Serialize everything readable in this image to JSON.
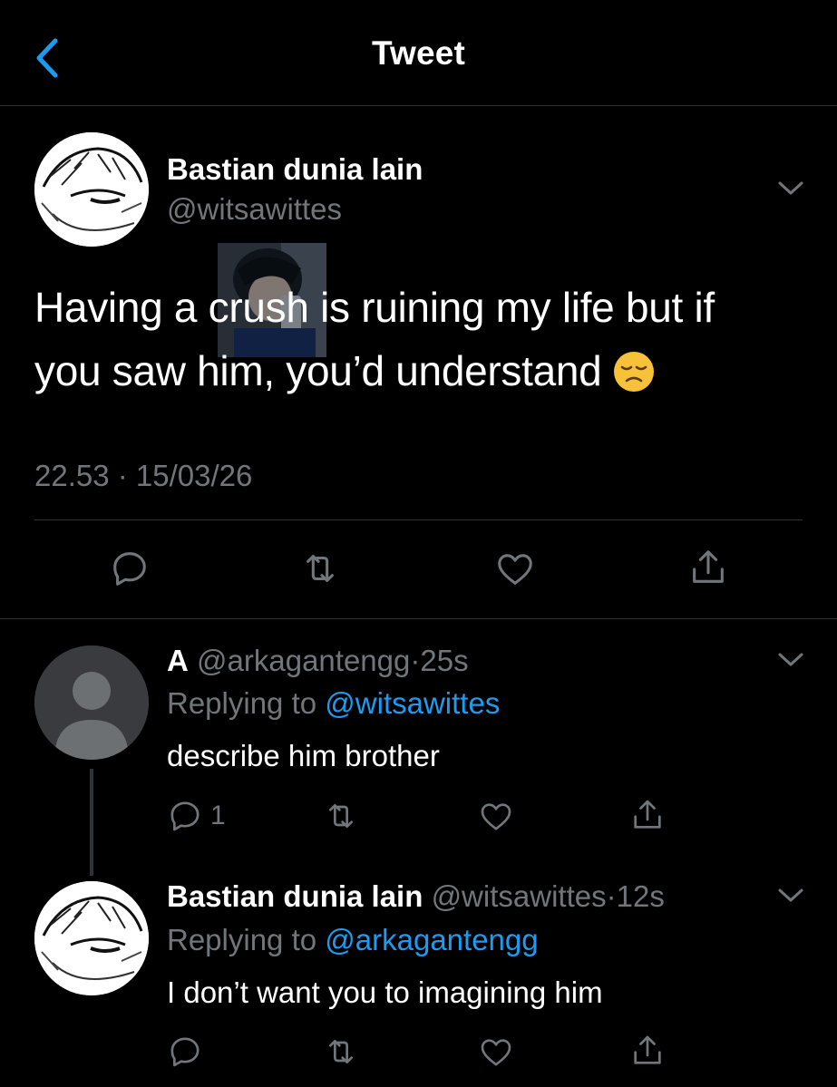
{
  "header": {
    "title": "Tweet"
  },
  "main_tweet": {
    "display_name": "Bastian dunia lain",
    "handle": "@witsawittes",
    "text_line1": "Having a crush is ruining my life but if",
    "text_line2": "you saw him, you’d understand",
    "timestamp": "22.53 · 15/03/26"
  },
  "replies": [
    {
      "display_name": "A",
      "handle": "@arkagantengg",
      "sep": "·",
      "age": "25s",
      "replying_prefix": "Replying to",
      "replying_to": "@witsawittes",
      "text": "describe him brother",
      "reply_count": "1"
    },
    {
      "display_name": "Bastian dunia lain",
      "handle": "@witsawittes",
      "sep": "·",
      "age": "12s",
      "replying_prefix": "Replying to",
      "replying_to": "@arkagantengg",
      "text": "I don’t want you to imagining him",
      "reply_count": ""
    }
  ],
  "icons": {
    "back": "chevron-left-icon",
    "more": "chevron-down-icon",
    "reply": "reply-icon",
    "retweet": "retweet-icon",
    "like": "heart-icon",
    "share": "share-icon",
    "emoji": "disappointed-face-emoji"
  },
  "colors": {
    "background": "#000000",
    "text": "#ffffff",
    "muted": "#71767b",
    "accent": "#1d9bf0",
    "divider": "#2f3336"
  }
}
